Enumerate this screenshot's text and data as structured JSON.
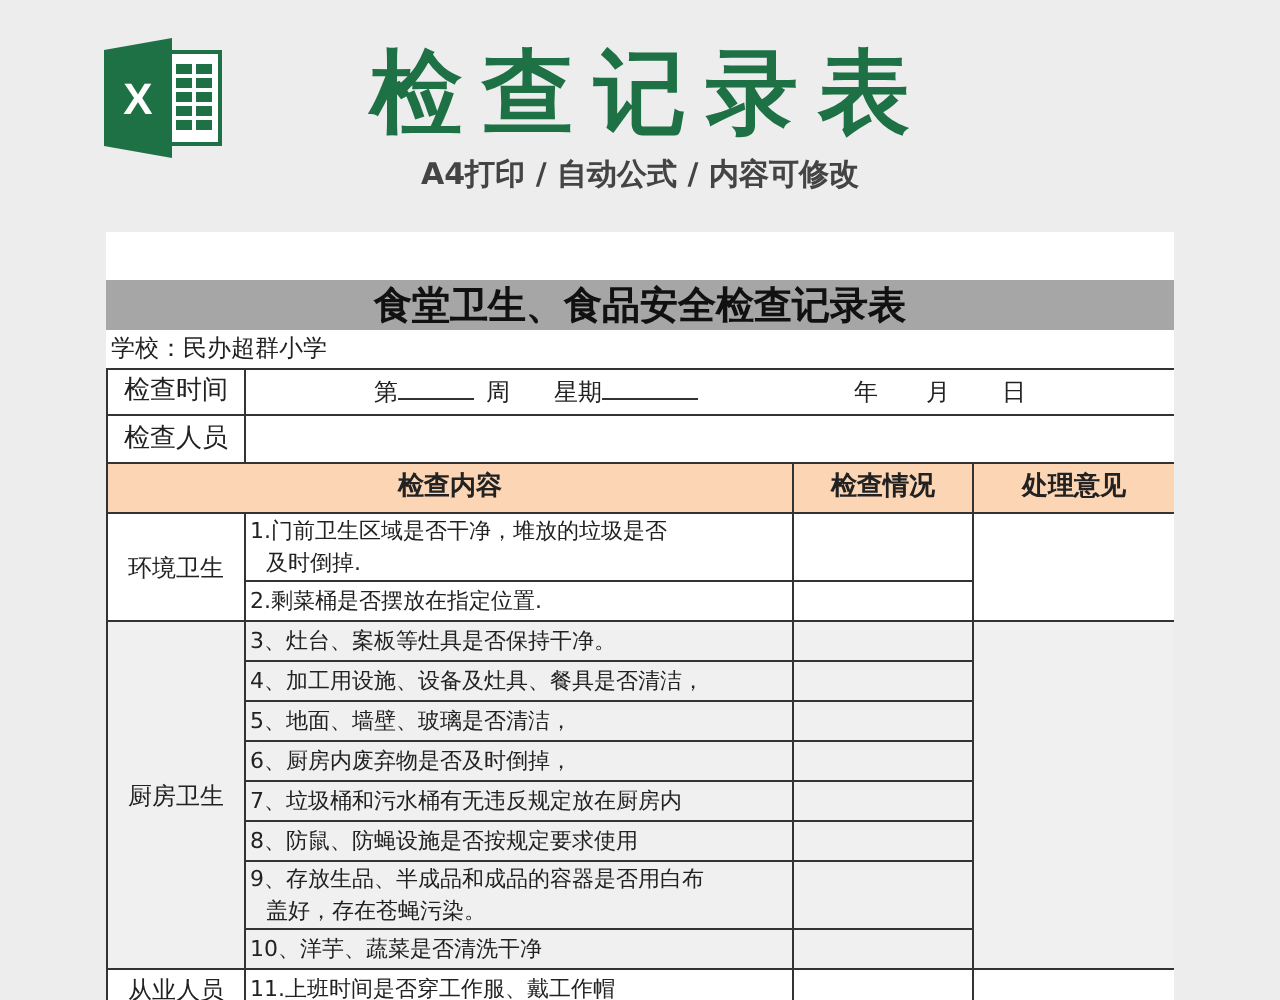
{
  "logo": {
    "letter": "X"
  },
  "title": "检查记录表",
  "subtitle": "A4打印 / 自动公式 / 内容可修改",
  "sheet": {
    "title": "食堂卫生、食品安全检查记录表",
    "school": "学校：民办超群小学",
    "time_label": "检查时间",
    "time_parts": {
      "week_prefix": "第",
      "week_suffix": "周",
      "weekday": "星期",
      "year": "年",
      "month": "月",
      "day": "日"
    },
    "people_label": "检查人员",
    "columns": [
      "检查内容",
      "检查情况",
      "处理意见"
    ],
    "groups": [
      {
        "name": "环境卫生",
        "items": [
          {
            "lines": [
              "1.门前卫生区域是否干净，堆放的垃圾是否",
              "及时倒掉."
            ]
          },
          {
            "text": "2.剩菜桶是否摆放在指定位置."
          }
        ]
      },
      {
        "name": "厨房卫生",
        "items": [
          {
            "text": "3、灶台、案板等灶具是否保持干净。"
          },
          {
            "text": "4、加工用设施、设备及灶具、餐具是否清洁，"
          },
          {
            "text": "5、地面、墙壁、玻璃是否清洁，"
          },
          {
            "text": "6、厨房内废弃物是否及时倒掉，"
          },
          {
            "text": "7、垃圾桶和污水桶有无违反规定放在厨房内"
          },
          {
            "text": "8、防鼠、防蝇设施是否按规定要求使用"
          },
          {
            "lines": [
              "9、存放生品、半成品和成品的容器是否用白布",
              "盖好，存在苍蝇污染。"
            ]
          },
          {
            "text": "10、洋芋、蔬菜是否清洗干净"
          }
        ]
      },
      {
        "name": "从业人员",
        "items": [
          {
            "text": "11.上班时间是否穿工作服、戴工作帽"
          }
        ]
      }
    ]
  }
}
